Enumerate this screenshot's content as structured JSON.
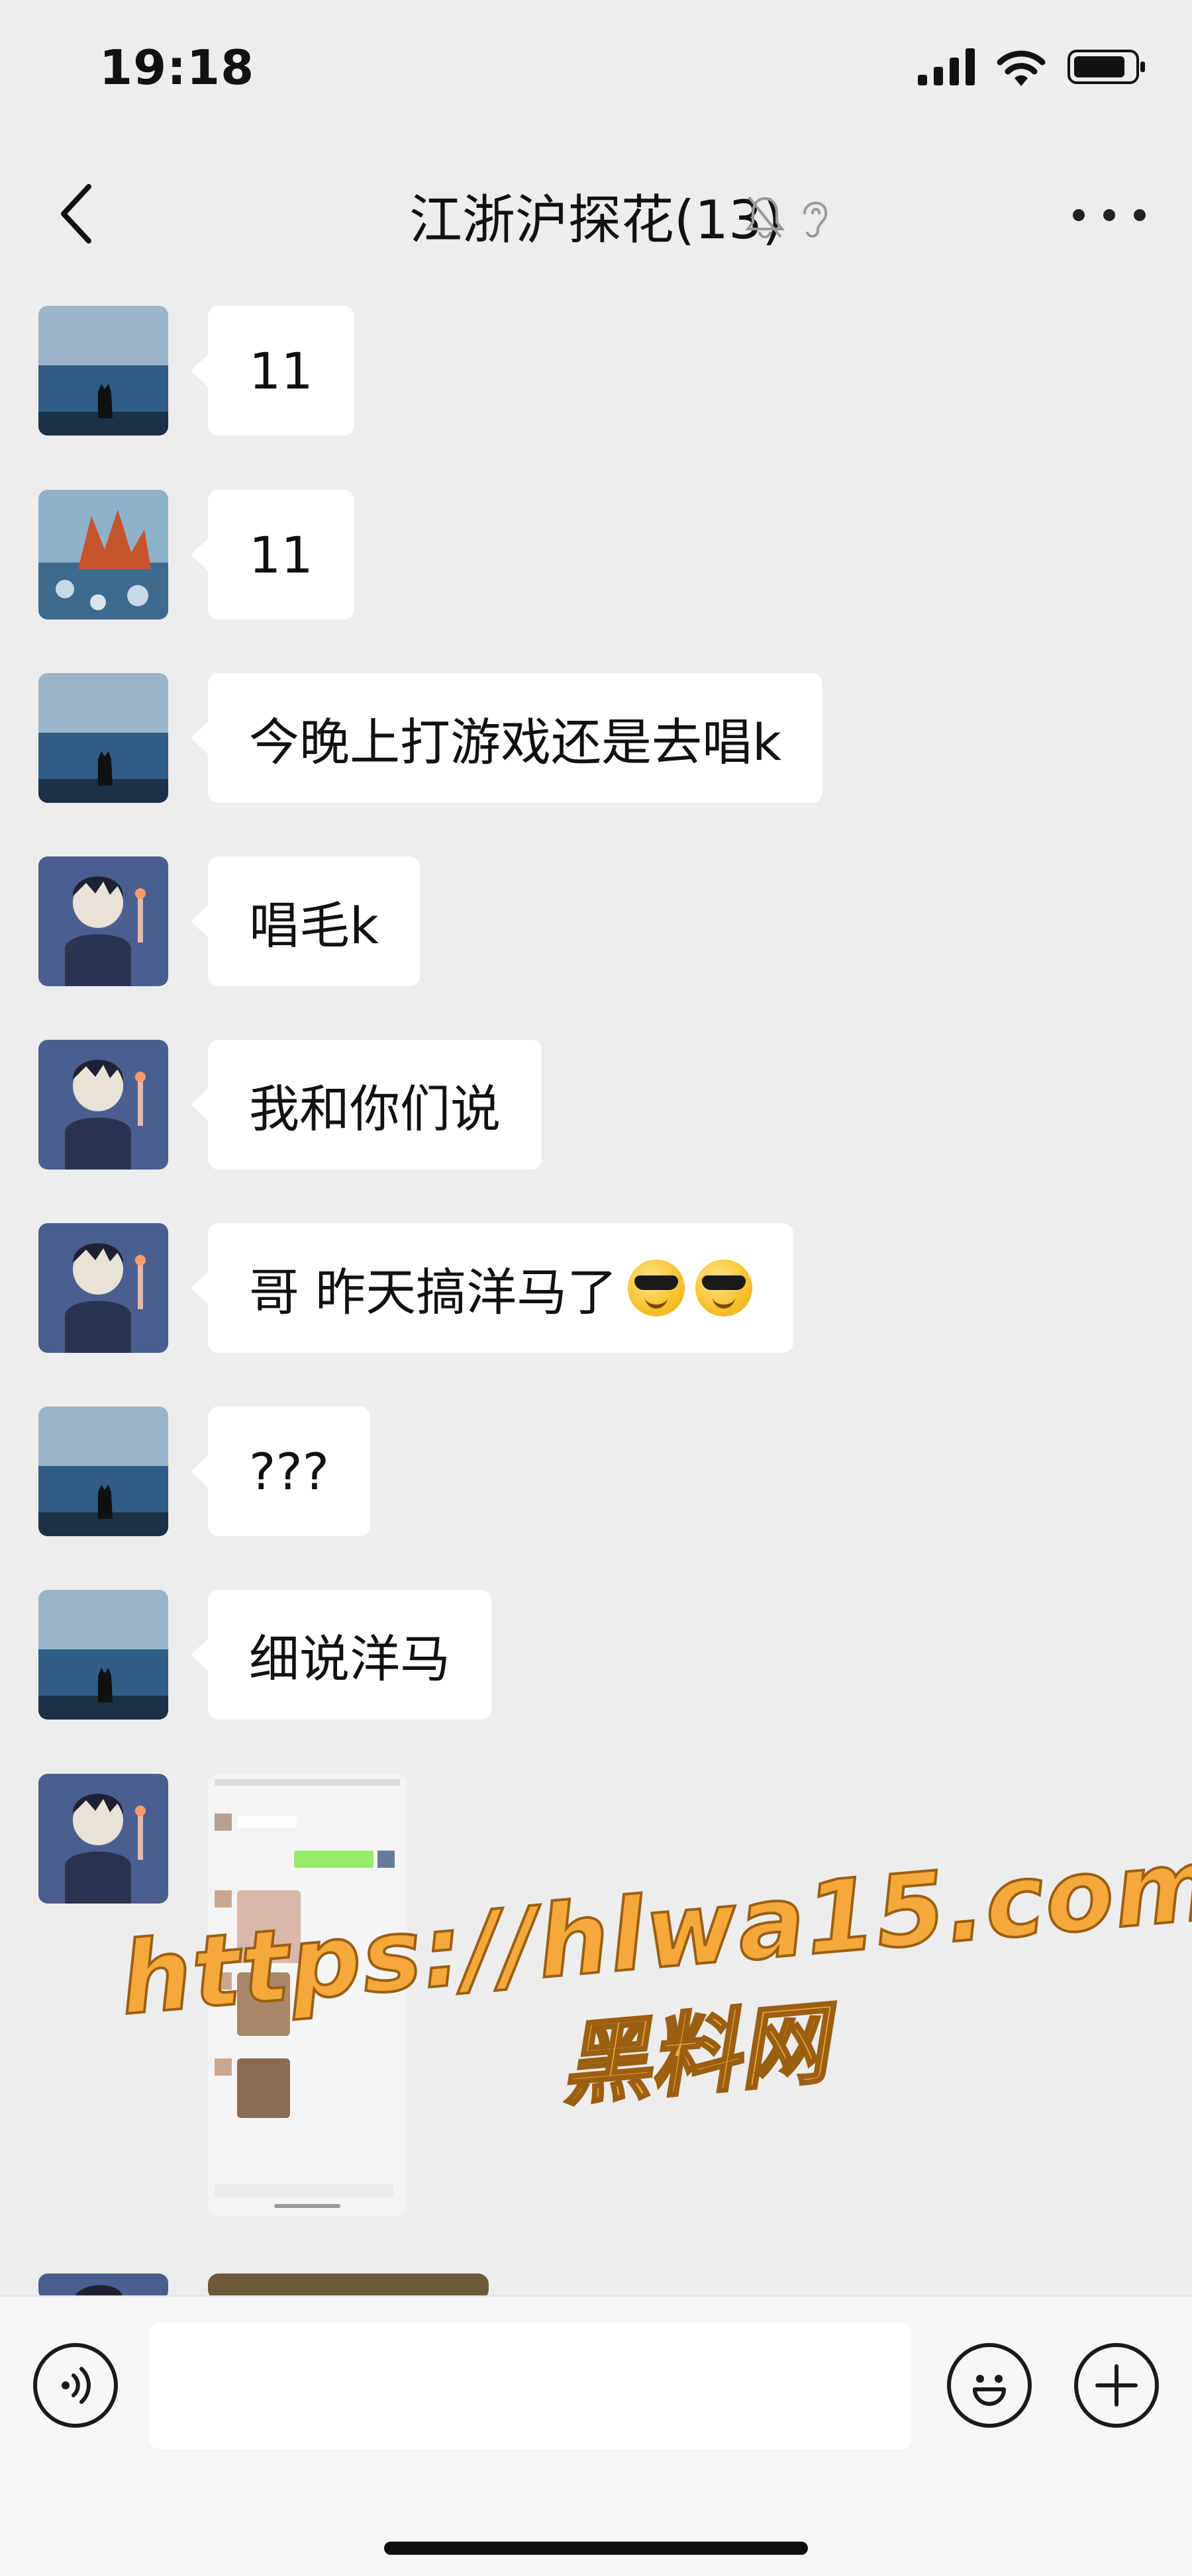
{
  "status_bar": {
    "time": "19:18"
  },
  "header": {
    "title": "江浙沪探花(13)"
  },
  "messages": [
    {
      "avatar": "cat-sea-avatar",
      "text": "11"
    },
    {
      "avatar": "coral-sea-avatar",
      "text": "11"
    },
    {
      "avatar": "cat-sea-avatar",
      "text": "今晚上打游戏还是去唱k"
    },
    {
      "avatar": "anime-boy-avatar",
      "text": "唱毛k"
    },
    {
      "avatar": "anime-boy-avatar",
      "text": "我和你们说"
    },
    {
      "avatar": "anime-boy-avatar",
      "text": "哥 昨天搞洋马了",
      "emojis": [
        "sunglasses-emoji",
        "sunglasses-emoji"
      ]
    },
    {
      "avatar": "cat-sea-avatar",
      "text": "???"
    },
    {
      "avatar": "cat-sea-avatar",
      "text": "细说洋马"
    },
    {
      "avatar": "anime-boy-avatar",
      "type": "image",
      "image": "chat-screenshot-thumbnail"
    }
  ],
  "watermark": {
    "url": "https://hlwa15.com",
    "label": "黑料网"
  },
  "input_bar": {
    "placeholder": "",
    "icons": [
      "voice-icon",
      "emoji-icon",
      "plus-icon"
    ]
  },
  "colors": {
    "background": "#ededed",
    "bubble": "#ffffff",
    "watermark": "#f5a93b"
  }
}
